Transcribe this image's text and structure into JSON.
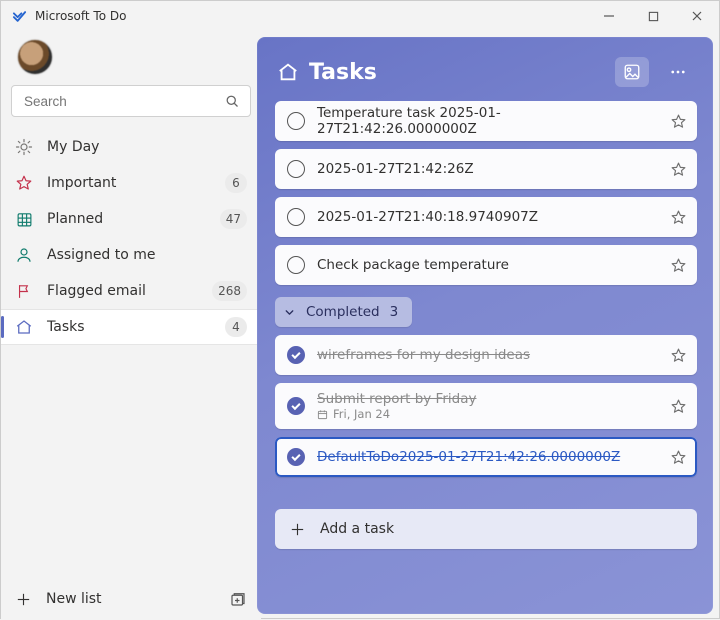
{
  "window": {
    "title": "Microsoft To Do"
  },
  "search": {
    "placeholder": "Search"
  },
  "sidebar": {
    "items": [
      {
        "id": "myday",
        "icon": "sun-icon",
        "label": "My Day",
        "count": null
      },
      {
        "id": "important",
        "icon": "star-icon",
        "label": "Important",
        "count": "6"
      },
      {
        "id": "planned",
        "icon": "calendar-icon",
        "label": "Planned",
        "count": "47"
      },
      {
        "id": "assigned",
        "icon": "person-icon",
        "label": "Assigned to me",
        "count": null
      },
      {
        "id": "flagged",
        "icon": "flag-icon",
        "label": "Flagged email",
        "count": "268"
      },
      {
        "id": "tasks",
        "icon": "home-icon",
        "label": "Tasks",
        "count": "4"
      }
    ],
    "active_id": "tasks",
    "new_list_label": "New list"
  },
  "main": {
    "title": "Tasks",
    "add_task_label": "Add a task",
    "completed_header": {
      "label": "Completed",
      "count": "3"
    },
    "open_tasks": [
      {
        "text": "Temperature task 2025-01-27T21:42:26.0000000Z"
      },
      {
        "text": "2025-01-27T21:42:26Z"
      },
      {
        "text": "2025-01-27T21:40:18.9740907Z"
      },
      {
        "text": "Check package temperature"
      }
    ],
    "completed_tasks": [
      {
        "text": "wireframes for my design ideas",
        "sub": null,
        "selected": false
      },
      {
        "text": "Submit report by Friday",
        "sub": "Fri, Jan 24",
        "selected": false
      },
      {
        "text": "DefaultToDo2025-01-27T21:42:26.0000000Z",
        "sub": null,
        "selected": true
      }
    ]
  }
}
